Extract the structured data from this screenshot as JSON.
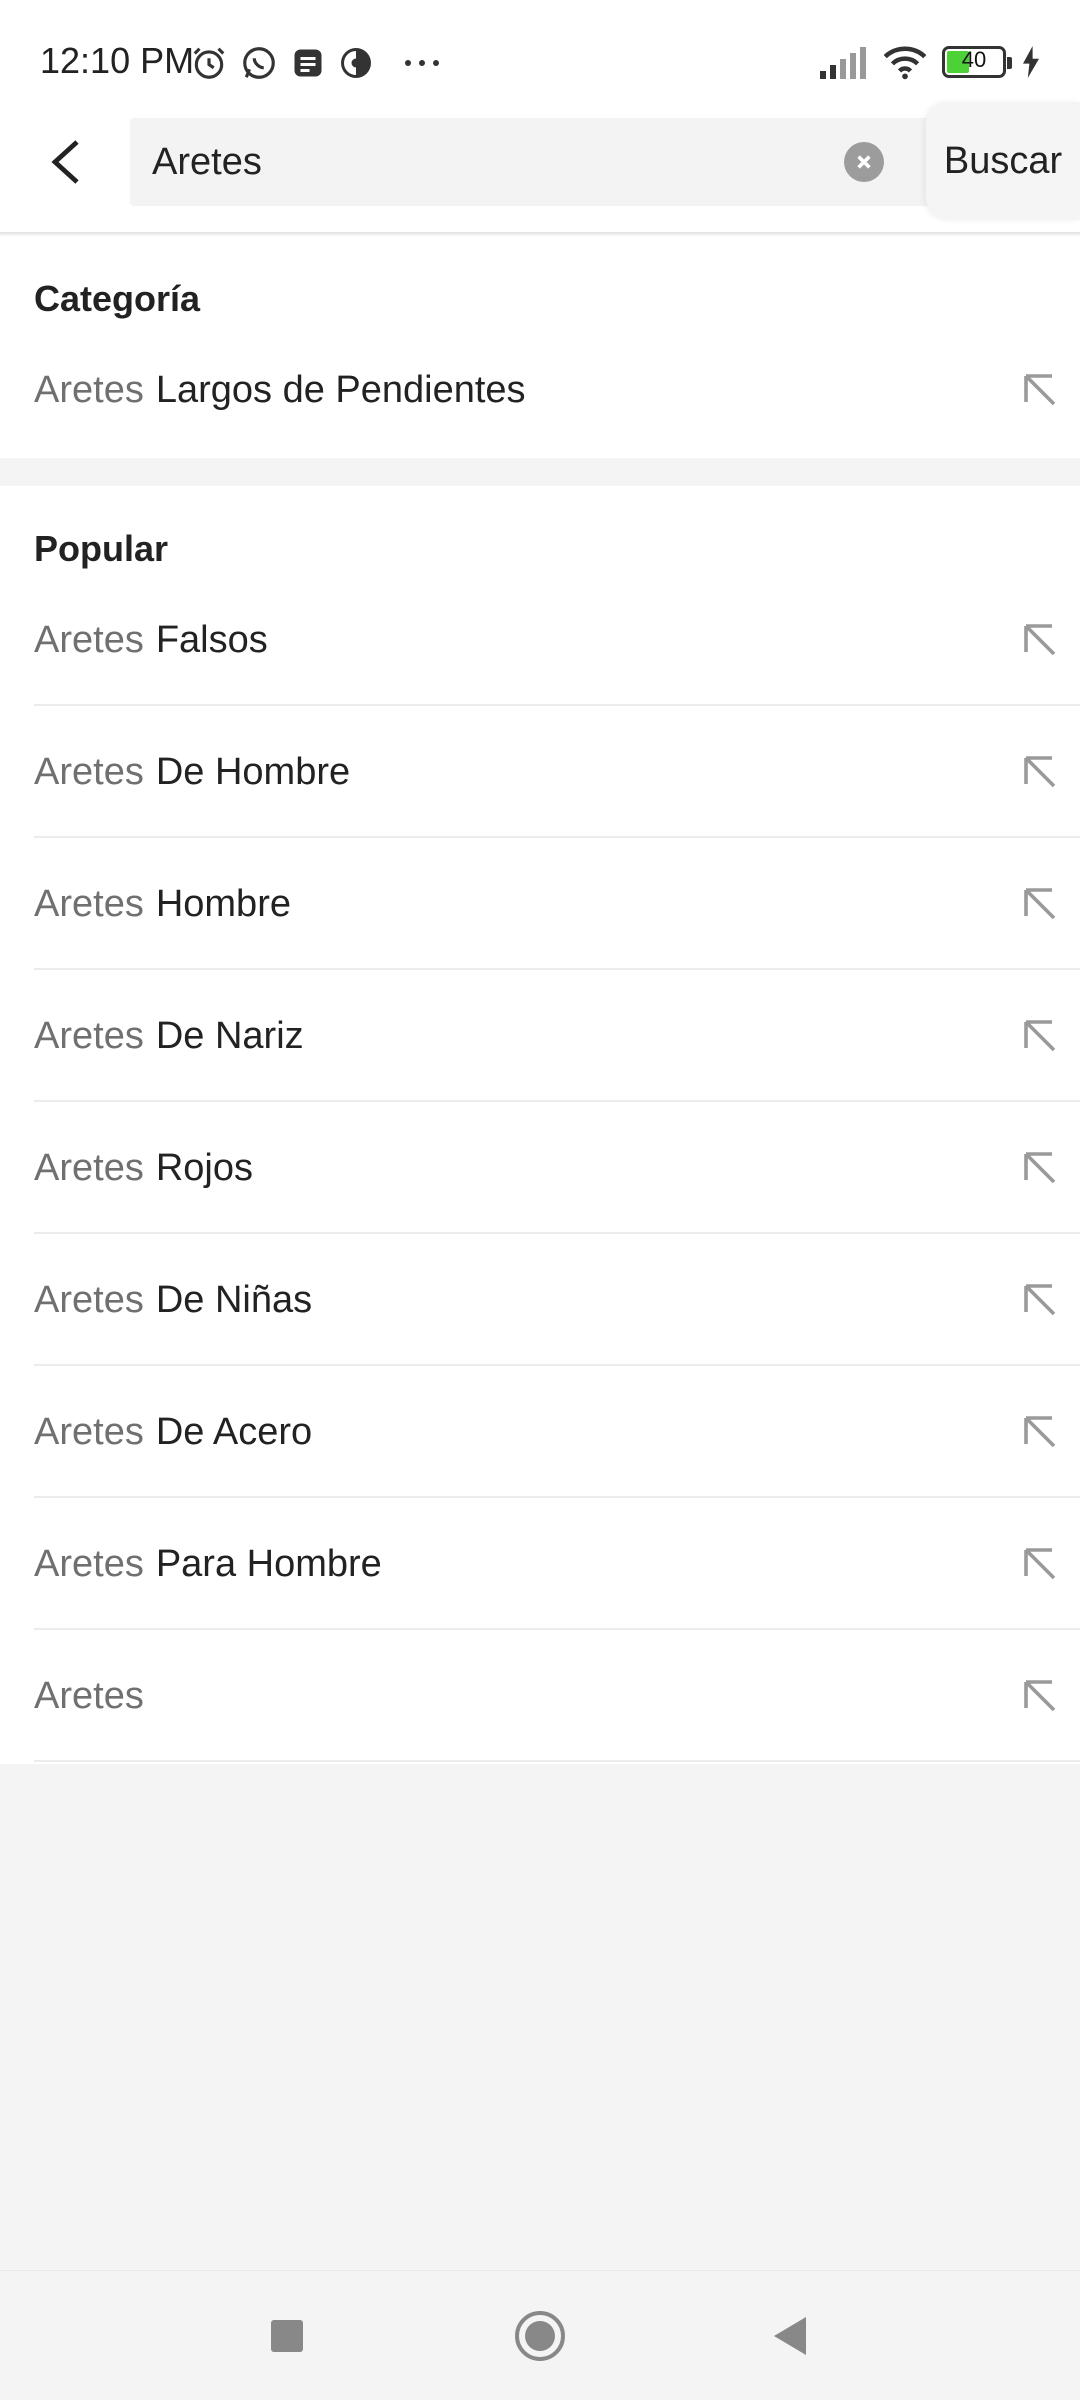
{
  "status_bar": {
    "time": "12:10 PM",
    "battery": "40",
    "icons": [
      "alarm-icon",
      "whatsapp-icon",
      "message-icon",
      "app-icon",
      "more-dots-icon",
      "signal-icon",
      "wifi-icon",
      "battery-icon",
      "charging-icon"
    ]
  },
  "search": {
    "value": "Aretes",
    "button_label": "Buscar"
  },
  "category": {
    "title": "Categoría",
    "items": [
      {
        "prefix": "Aretes",
        "rest": "Largos de Pendientes"
      }
    ]
  },
  "popular": {
    "title": "Popular",
    "items": [
      {
        "prefix": "Aretes",
        "rest": "Falsos"
      },
      {
        "prefix": "Aretes",
        "rest": "De Hombre"
      },
      {
        "prefix": "Aretes",
        "rest": "Hombre"
      },
      {
        "prefix": "Aretes",
        "rest": "De Nariz"
      },
      {
        "prefix": "Aretes",
        "rest": "Rojos"
      },
      {
        "prefix": "Aretes",
        "rest": "De Niñas"
      },
      {
        "prefix": "Aretes",
        "rest": "De Acero"
      },
      {
        "prefix": "Aretes",
        "rest": "Para Hombre"
      },
      {
        "prefix": "Aretes",
        "rest": ""
      }
    ]
  },
  "nav": {
    "buttons": [
      "recents-square-icon",
      "home-circle-icon",
      "back-triangle-icon"
    ]
  },
  "colors": {
    "background": "#f4f4f4",
    "surface": "#ffffff",
    "text_primary": "#222222",
    "text_secondary": "#707070",
    "battery_fill": "#4cd137"
  }
}
